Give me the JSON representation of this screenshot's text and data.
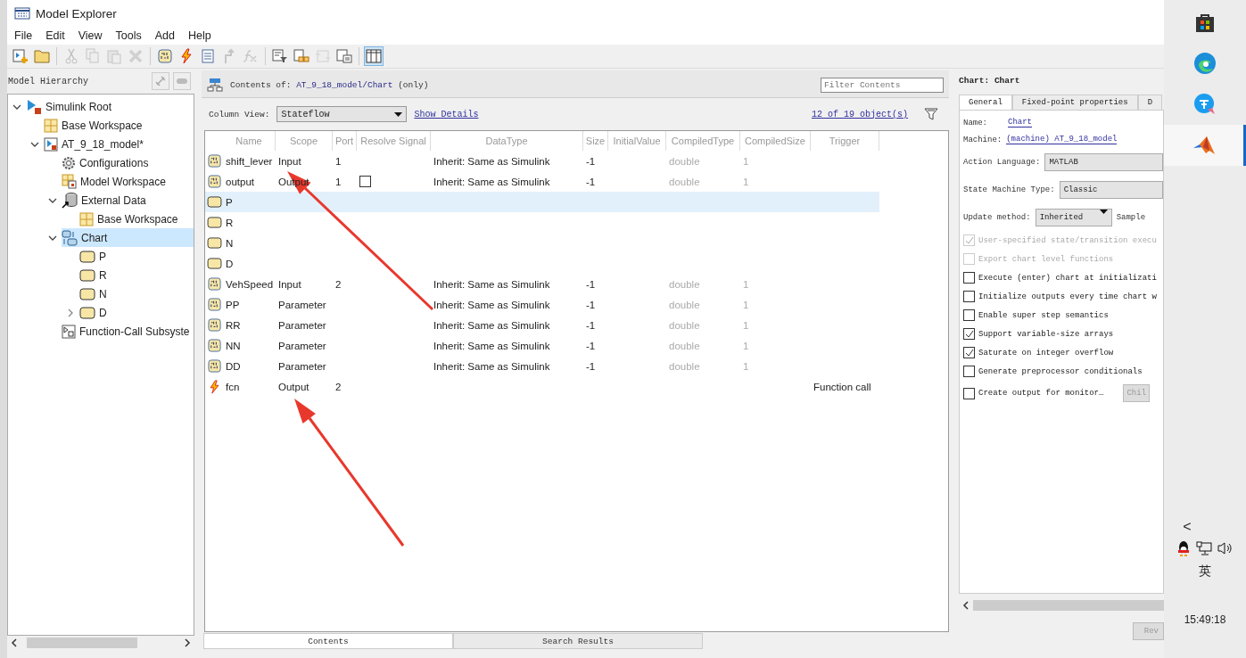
{
  "window": {
    "title": "Model Explorer"
  },
  "menu": [
    "File",
    "Edit",
    "View",
    "Tools",
    "Add",
    "Help"
  ],
  "toolbar": [
    [
      {
        "kind": "new-model",
        "disabled": false,
        "pressed": false
      },
      {
        "kind": "open-folder",
        "disabled": false,
        "pressed": false
      }
    ],
    [
      {
        "kind": "cut",
        "disabled": true,
        "pressed": false
      },
      {
        "kind": "copy",
        "disabled": true,
        "pressed": false
      },
      {
        "kind": "paste",
        "disabled": true,
        "pressed": false
      },
      {
        "kind": "delete",
        "disabled": true,
        "pressed": false
      }
    ],
    [
      {
        "kind": "data",
        "disabled": false,
        "pressed": false
      },
      {
        "kind": "event",
        "disabled": false,
        "pressed": false
      },
      {
        "kind": "note",
        "disabled": false,
        "pressed": false
      },
      {
        "kind": "transition",
        "disabled": true,
        "pressed": false
      },
      {
        "kind": "function",
        "disabled": true,
        "pressed": false
      }
    ],
    [
      {
        "kind": "filter",
        "disabled": false,
        "pressed": false
      },
      {
        "kind": "bus",
        "disabled": false,
        "pressed": false
      },
      {
        "kind": "refresh",
        "disabled": true,
        "pressed": false
      },
      {
        "kind": "report",
        "disabled": false,
        "pressed": false
      }
    ],
    [
      {
        "kind": "columns",
        "disabled": false,
        "pressed": true
      }
    ]
  ],
  "hierarchy": {
    "title": "Model Hierarchy",
    "tree": [
      {
        "label": "Simulink Root",
        "kind": "root",
        "expanded": true,
        "selected": false,
        "children": [
          {
            "label": "Base Workspace",
            "kind": "workspace",
            "selected": false
          },
          {
            "label": "AT_9_18_model*",
            "kind": "model",
            "expanded": true,
            "selected": false,
            "children": [
              {
                "label": "Configurations",
                "kind": "config",
                "selected": false
              },
              {
                "label": "Model Workspace",
                "kind": "model-workspace",
                "selected": false
              },
              {
                "label": "External Data",
                "kind": "external-data",
                "expanded": true,
                "selected": false,
                "children": [
                  {
                    "label": "Base Workspace",
                    "kind": "workspace",
                    "selected": false
                  }
                ]
              },
              {
                "label": "Chart",
                "kind": "chart",
                "expanded": true,
                "selected": true,
                "children": [
                  {
                    "label": "P",
                    "kind": "state",
                    "selected": false
                  },
                  {
                    "label": "R",
                    "kind": "state",
                    "selected": false
                  },
                  {
                    "label": "N",
                    "kind": "state",
                    "selected": false
                  },
                  {
                    "label": "D",
                    "kind": "state",
                    "expanded": false,
                    "selected": false
                  }
                ]
              },
              {
                "label": "Function-Call Subsyste",
                "kind": "subsystem",
                "selected": false
              }
            ]
          }
        ]
      }
    ]
  },
  "contents": {
    "label": "Contents of:",
    "path": "AT_9_18_model/Chart",
    "suffix": "(only)",
    "filter_placeholder": "Filter Contents",
    "column_view_label": "Column View:",
    "column_view": "Stateflow",
    "show_details": "Show Details",
    "object_count": "12 of 19 object(s)"
  },
  "table": {
    "columns": [
      "Name",
      "Scope",
      "Port",
      "Resolve Signal",
      "DataType",
      "Size",
      "InitialValue",
      "CompiledType",
      "CompiledSize",
      "Trigger"
    ],
    "rows": [
      {
        "kind": "data",
        "name": "shift_lever",
        "scope": "Input",
        "port": "1",
        "datatype": "Inherit: Same as Simulink",
        "size": "-1",
        "compiled_type": "double",
        "compiled_size": "1",
        "selected": false
      },
      {
        "kind": "data",
        "name": "output",
        "scope": "Output",
        "port": "1",
        "resolve_signal": false,
        "datatype": "Inherit: Same as Simulink",
        "size": "-1",
        "compiled_type": "double",
        "compiled_size": "1",
        "selected": false
      },
      {
        "kind": "state",
        "name": "P",
        "selected": true
      },
      {
        "kind": "state",
        "name": "R",
        "selected": false
      },
      {
        "kind": "state",
        "name": "N",
        "selected": false
      },
      {
        "kind": "state",
        "name": "D",
        "selected": false
      },
      {
        "kind": "data",
        "name": "VehSpeed",
        "scope": "Input",
        "port": "2",
        "datatype": "Inherit: Same as Simulink",
        "size": "-1",
        "compiled_type": "double",
        "compiled_size": "1",
        "selected": false
      },
      {
        "kind": "data",
        "name": "PP",
        "scope": "Parameter",
        "datatype": "Inherit: Same as Simulink",
        "size": "-1",
        "compiled_type": "double",
        "compiled_size": "1",
        "selected": false
      },
      {
        "kind": "data",
        "name": "RR",
        "scope": "Parameter",
        "datatype": "Inherit: Same as Simulink",
        "size": "-1",
        "compiled_type": "double",
        "compiled_size": "1",
        "selected": false
      },
      {
        "kind": "data",
        "name": "NN",
        "scope": "Parameter",
        "datatype": "Inherit: Same as Simulink",
        "size": "-1",
        "compiled_type": "double",
        "compiled_size": "1",
        "selected": false
      },
      {
        "kind": "data",
        "name": "DD",
        "scope": "Parameter",
        "datatype": "Inherit: Same as Simulink",
        "size": "-1",
        "compiled_type": "double",
        "compiled_size": "1",
        "selected": false
      },
      {
        "kind": "event",
        "name": "fcn",
        "scope": "Output",
        "port": "2",
        "trigger": "Function call",
        "selected": false
      }
    ]
  },
  "bottom_tabs": [
    {
      "label": "Contents",
      "selected": true
    },
    {
      "label": "Search Results",
      "selected": false
    }
  ],
  "properties": {
    "title": "Chart: Chart",
    "tabs": [
      {
        "label": "General",
        "selected": true
      },
      {
        "label": "Fixed-point properties",
        "selected": false
      },
      {
        "label": "D",
        "selected": false
      }
    ],
    "name_label": "Name:",
    "name": "Chart",
    "machine_label": "Machine:",
    "machine": "(machine) AT_9_18_model",
    "action_language_label": "Action Language:",
    "action_language": "MATLAB",
    "state_machine_label": "State Machine Type:",
    "state_machine": "Classic",
    "update_method_label": "Update method:",
    "update_method": "Inherited",
    "sample_label": "Sample",
    "options": [
      {
        "label": "User-specified state/transition execu",
        "checked": true,
        "disabled": true
      },
      {
        "label": "Export chart level functions",
        "checked": false,
        "disabled": true
      },
      {
        "label": "Execute (enter) chart at initializati",
        "checked": false,
        "disabled": false
      },
      {
        "label": "Initialize outputs every time chart w",
        "checked": false,
        "disabled": false
      },
      {
        "label": "Enable super step semantics",
        "checked": false,
        "disabled": false
      },
      {
        "label": "Support variable-size arrays",
        "checked": true,
        "disabled": false
      },
      {
        "label": "Saturate on integer overflow",
        "checked": true,
        "disabled": false
      },
      {
        "label": "Generate preprocessor conditionals",
        "checked": false,
        "disabled": false
      }
    ],
    "monitor": {
      "label": "Create output for monitor…",
      "checked": false,
      "button": "Chil"
    },
    "revert_button": "Rev"
  },
  "taskbar": {
    "apps": [
      {
        "kind": "store",
        "active": false
      },
      {
        "kind": "browser",
        "active": false
      },
      {
        "kind": "translate",
        "active": false
      },
      {
        "kind": "matlab",
        "active": true
      }
    ],
    "chevron": "<",
    "ime": "英",
    "time": "15:49:18"
  }
}
